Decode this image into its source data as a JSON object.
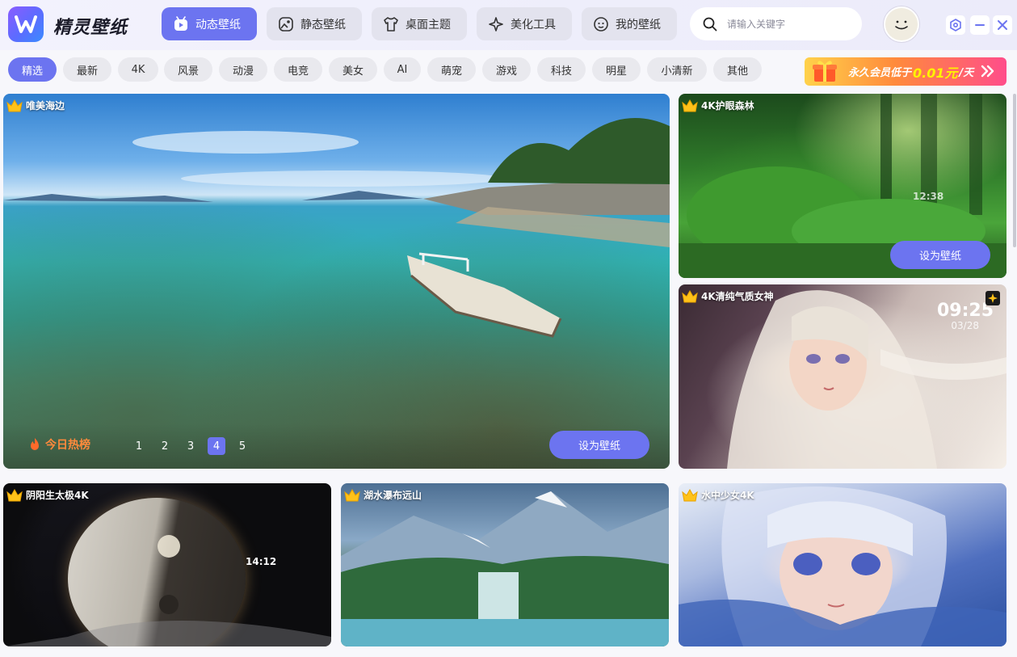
{
  "app": {
    "name": "精灵壁纸"
  },
  "nav": [
    {
      "label": "动态壁纸",
      "icon": "play-icon",
      "active": true
    },
    {
      "label": "静态壁纸",
      "icon": "picture-icon",
      "active": false
    },
    {
      "label": "桌面主题",
      "icon": "shirt-icon",
      "active": false
    },
    {
      "label": "美化工具",
      "icon": "sparkle-icon",
      "active": false
    },
    {
      "label": "我的壁纸",
      "icon": "smile-icon",
      "active": false
    }
  ],
  "search": {
    "placeholder": "请输入关键字"
  },
  "categories": [
    "精选",
    "最新",
    "4K",
    "风景",
    "动漫",
    "电竞",
    "美女",
    "AI",
    "萌宠",
    "游戏",
    "科技",
    "明星",
    "小清新",
    "其他"
  ],
  "active_category": "精选",
  "promo": {
    "prefix": "永久会员低于",
    "price": "0.01元",
    "suffix": "/天"
  },
  "featured": {
    "title": "唯美海边",
    "hot_label": "今日热榜",
    "pages": [
      "1",
      "2",
      "3",
      "4",
      "5"
    ],
    "current_page": "4",
    "set_label": "设为壁纸"
  },
  "side_cards": [
    {
      "title": "4K护眼森林",
      "clock": "12:38",
      "set_label": "设为壁纸"
    },
    {
      "title": "4K清纯气质女神",
      "clock": "09:25",
      "date": "03/28"
    }
  ],
  "bottom_cards": [
    {
      "title": "阴阳生太极4K",
      "clock": "14:12"
    },
    {
      "title": "湖水瀑布远山"
    },
    {
      "title": "水中少女4K"
    }
  ],
  "colors": {
    "accent": "#6c74f0",
    "hot": "#ff8a3c"
  }
}
